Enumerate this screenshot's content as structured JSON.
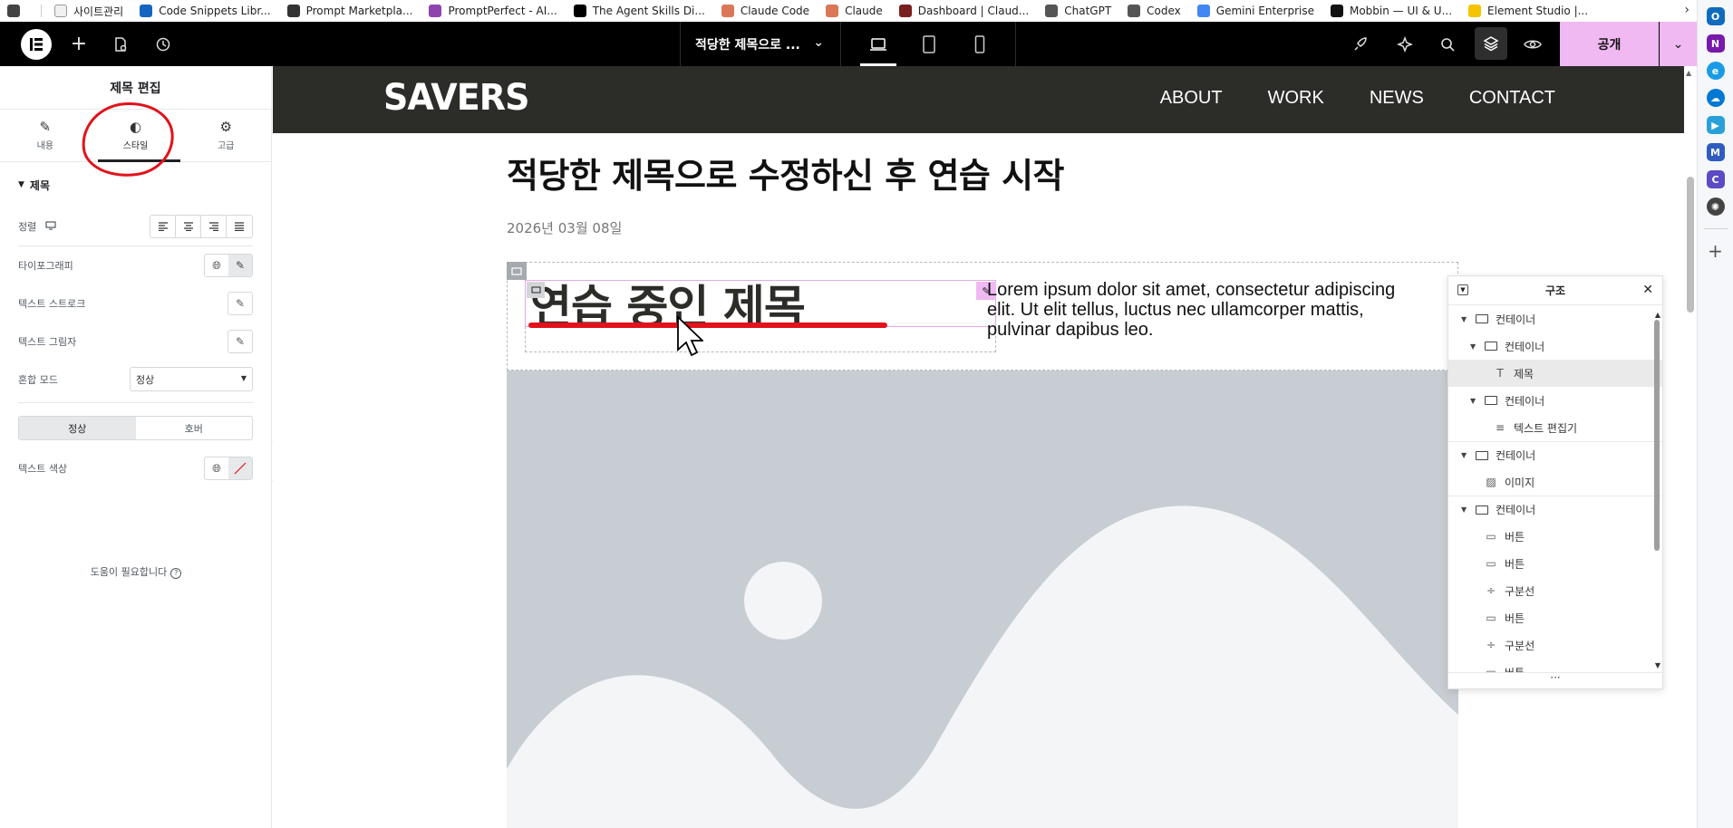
{
  "bookmarks": [
    {
      "label": "",
      "color": "#444"
    },
    {
      "label": "사이트관리",
      "color": "#f0f0f0"
    },
    {
      "label": "Code Snippets Libr...",
      "color": "#1565c0"
    },
    {
      "label": "Prompt Marketpla...",
      "color": "#333333"
    },
    {
      "label": "PromptPerfect - AI...",
      "color": "#8e44ad"
    },
    {
      "label": "The Agent Skills Di...",
      "color": "#000000"
    },
    {
      "label": "Claude Code",
      "color": "#d97757"
    },
    {
      "label": "Claude",
      "color": "#d97757"
    },
    {
      "label": "Dashboard | Claud...",
      "color": "#7a1f1f"
    },
    {
      "label": "ChatGPT",
      "color": "#555555"
    },
    {
      "label": "Codex",
      "color": "#555555"
    },
    {
      "label": "Gemini Enterprise",
      "color": "#4285f4"
    },
    {
      "label": "Mobbin — UI & U...",
      "color": "#111111"
    },
    {
      "label": "Element Studio |...",
      "color": "#f5c400"
    }
  ],
  "topbar": {
    "doc_title": "적당한 제목으로 ...",
    "publish_label": "공개"
  },
  "panel": {
    "title": "제목 편집",
    "tabs": [
      {
        "label": "내용",
        "icon": "pencil-icon"
      },
      {
        "label": "스타일",
        "icon": "half-circle-icon"
      },
      {
        "label": "고급",
        "icon": "gear-icon"
      }
    ],
    "section_title": "제목",
    "alignment_label": "정렬",
    "typography_label": "타이포그래피",
    "text_stroke_label": "텍스트 스트로크",
    "text_shadow_label": "텍스트 그림자",
    "blend_mode_label": "혼합 모드",
    "blend_mode_value": "정상",
    "state_normal": "정상",
    "state_hover": "호버",
    "text_color_label": "텍스트 색상",
    "help_text": "도움이 필요합니다"
  },
  "site": {
    "logo": "SAVERS",
    "nav": [
      "ABOUT",
      "WORK",
      "NEWS",
      "CONTACT"
    ],
    "post_title": "적당한 제목으로 수정하신 후 연습 시작",
    "post_date": "2026년 03월 08일",
    "heading": "연습 중인 제목",
    "lorem": "Lorem ipsum dolor sit amet, consectetur adipiscing elit. Ut elit tellus, luctus nec ullamcorper mattis, pulvinar dapibus leo."
  },
  "navigator": {
    "title": "구조",
    "items": [
      {
        "label": "컨테이너",
        "level": 0,
        "icon": "container",
        "expanded": true
      },
      {
        "label": "컨테이너",
        "level": 1,
        "icon": "container",
        "expanded": true
      },
      {
        "label": "제목",
        "level": 2,
        "icon": "heading",
        "selected": true
      },
      {
        "label": "컨테이너",
        "level": 1,
        "icon": "container",
        "expanded": true
      },
      {
        "label": "텍스트 편집기",
        "level": 2,
        "icon": "text"
      },
      {
        "label": "컨테이너",
        "level": 0,
        "icon": "container",
        "expanded": true
      },
      {
        "label": "이미지",
        "level": 1,
        "icon": "image"
      },
      {
        "label": "컨테이너",
        "level": 0,
        "icon": "container",
        "expanded": true
      },
      {
        "label": "버튼",
        "level": 1,
        "icon": "button"
      },
      {
        "label": "버튼",
        "level": 1,
        "icon": "button"
      },
      {
        "label": "구분선",
        "level": 1,
        "icon": "divider"
      },
      {
        "label": "버튼",
        "level": 1,
        "icon": "button"
      },
      {
        "label": "구분선",
        "level": 1,
        "icon": "divider"
      },
      {
        "label": "버튼",
        "level": 1,
        "icon": "button"
      }
    ],
    "footer": "···"
  },
  "colors": {
    "accent_pink": "#f0b9f2",
    "annotation_red": "#e1121b",
    "site_header": "#2c2c29",
    "image_placeholder": "#c7cdd2"
  }
}
